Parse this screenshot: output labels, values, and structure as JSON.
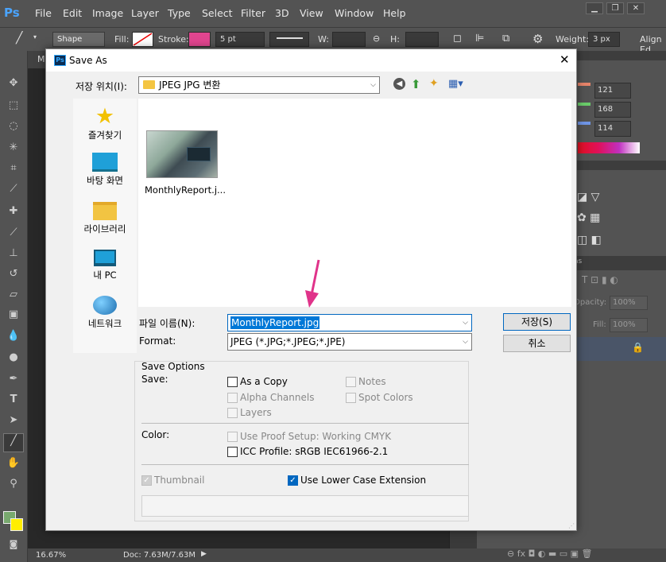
{
  "ps": {
    "logo": "Ps",
    "menu": [
      "File",
      "Edit",
      "Image",
      "Layer",
      "Type",
      "Select",
      "Filter",
      "3D",
      "View",
      "Window",
      "Help"
    ],
    "window_controls": [
      "▁",
      "❐",
      "✕"
    ]
  },
  "options_bar": {
    "mode": "Shape",
    "fill_label": "Fill:",
    "stroke_label": "Stroke:",
    "stroke_size": "5 pt",
    "w_label": "W:",
    "h_label": "H:",
    "weight_label": "Weight:",
    "weight_value": "3 px",
    "align_edges": "Align Ed"
  },
  "doc_tab": "M",
  "status": {
    "zoom": "16.67%",
    "doc": "Doc: 7.63M/7.63M"
  },
  "right_panel": {
    "r": "121",
    "g": "168",
    "b": "114",
    "tab_fragment": "as",
    "opacity_label": "Opacity:",
    "opacity_value": "100%",
    "fill_label": "Fill:",
    "fill_value": "100%"
  },
  "dialog": {
    "title": "Save As",
    "location_label": "저장 위치(I):",
    "location_value": "JPEG JPG 변환",
    "places": [
      {
        "label": "즐겨찾기",
        "icon": "star-icon"
      },
      {
        "label": "바탕 화면",
        "icon": "desktop-icon"
      },
      {
        "label": "라이브러리",
        "icon": "library-icon"
      },
      {
        "label": "내 PC",
        "icon": "this-pc-icon"
      },
      {
        "label": "네트워크",
        "icon": "network-icon"
      }
    ],
    "file": {
      "name": "MonthlyReport.j..."
    },
    "filename_label": "파일 이름(N):",
    "filename_value": "MonthlyReport.jpg",
    "format_label": "Format:",
    "format_value": "JPEG (*.JPG;*.JPEG;*.JPE)",
    "save_button": "저장(S)",
    "cancel_button": "취소",
    "save_options": {
      "title": "Save Options",
      "save_label": "Save:",
      "as_a_copy": "As a Copy",
      "alpha_channels": "Alpha Channels",
      "layers": "Layers",
      "notes": "Notes",
      "spot_colors": "Spot Colors",
      "color_label": "Color:",
      "use_proof_setup": "Use Proof Setup:  Working CMYK",
      "icc_profile": "ICC Profile:  sRGB IEC61966-2.1",
      "thumbnail": "Thumbnail",
      "lower_case_ext": "Use Lower Case Extension"
    }
  },
  "colors": {
    "ps_bg": "#535353",
    "accent": "#0067c0",
    "arrow": "#e0338a"
  }
}
